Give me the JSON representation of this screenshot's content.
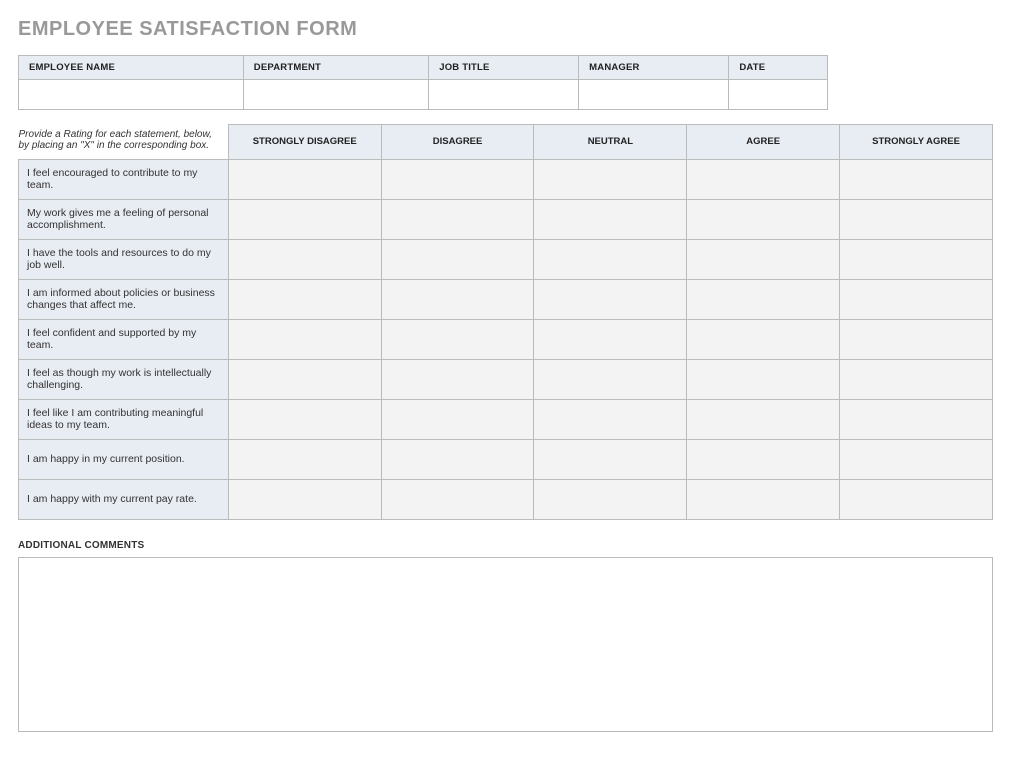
{
  "title": "EMPLOYEE SATISFACTION FORM",
  "info_headers": [
    "EMPLOYEE NAME",
    "DEPARTMENT",
    "JOB TITLE",
    "MANAGER",
    "DATE"
  ],
  "info_values": [
    "",
    "",
    "",
    "",
    ""
  ],
  "instruction": "Provide a Rating for each statement, below, by placing an \"X\" in the corresponding box.",
  "rating_columns": [
    "STRONGLY DISAGREE",
    "DISAGREE",
    "NEUTRAL",
    "AGREE",
    "STRONGLY AGREE"
  ],
  "statements": [
    "I feel encouraged to contribute to my team.",
    "My work gives me a feeling of personal accomplishment.",
    "I have the tools and resources to do my job well.",
    "I am informed about policies or business changes that affect me.",
    "I feel confident and supported by my team.",
    "I feel as though my work is intellectually challenging.",
    "I feel like I am contributing meaningful ideas to my team.",
    "I am happy in my current position.",
    "I am happy with my current pay rate."
  ],
  "comments_label": "ADDITIONAL COMMENTS",
  "comments_value": ""
}
